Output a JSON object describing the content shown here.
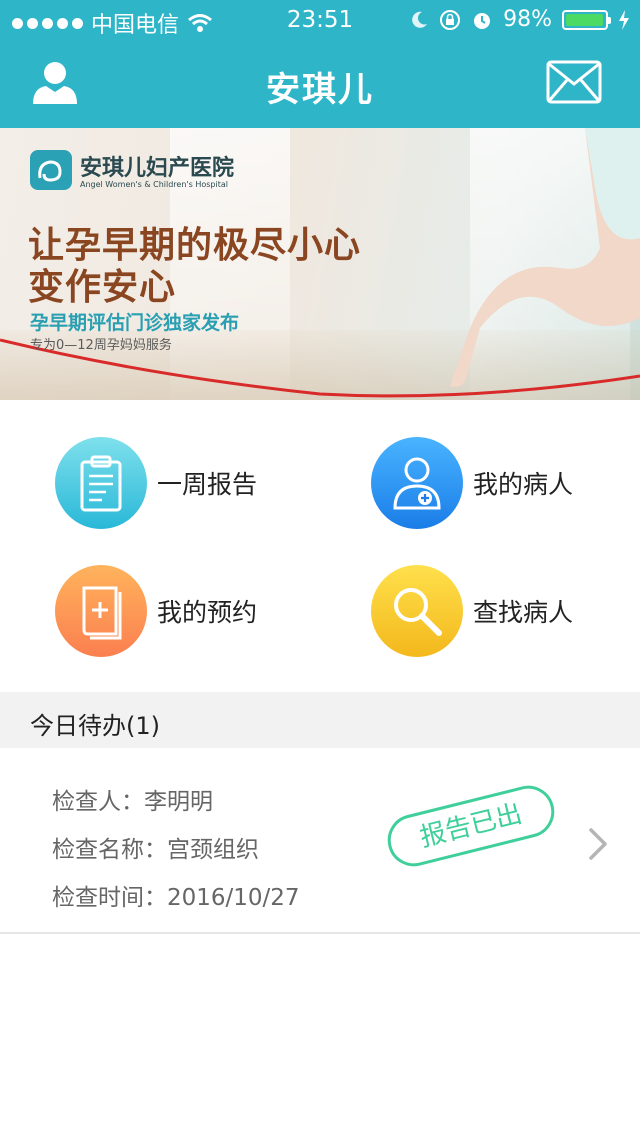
{
  "status_bar": {
    "carrier": "中国电信",
    "time": "23:51",
    "battery_percent": "98%",
    "battery_level": 0.98,
    "icons": [
      "signal-dots-icon",
      "wifi-icon",
      "moon-icon",
      "rotation-lock-icon",
      "alarm-icon",
      "battery-icon",
      "charging-icon"
    ]
  },
  "nav": {
    "title": "安琪儿",
    "left_icon": "user-icon",
    "right_icon": "mail-icon",
    "bar_color": "#2fb5c8"
  },
  "banner": {
    "logo_cn": "安琪儿妇产医院",
    "logo_en": "Angel Women's & Children's Hospital",
    "headline_line1": "让孕早期的极尽小心",
    "headline_line2": "变作安心",
    "subtitle": "孕早期评估门诊独家发布",
    "note": "专为0—12周孕妈妈服务"
  },
  "menu": [
    {
      "label": "一周报告",
      "icon": "clipboard-report-icon",
      "color_top": "#7fe0ec",
      "color_bottom": "#29b8d8"
    },
    {
      "label": "我的病人",
      "icon": "patient-avatar-icon",
      "color_top": "#49b4ff",
      "color_bottom": "#1a7de8"
    },
    {
      "label": "我的预约",
      "icon": "medical-book-icon",
      "color_top": "#ffb35c",
      "color_bottom": "#fb7f50"
    },
    {
      "label": "查找病人",
      "icon": "search-icon",
      "color_top": "#ffe04c",
      "color_bottom": "#f3b81c"
    }
  ],
  "todo": {
    "header": "今日待办(1)",
    "items": [
      {
        "examinee_label": "检查人：",
        "examinee": "李明明",
        "exam_name_label": "检查名称：",
        "exam_name": "宫颈组织",
        "exam_time_label": "检查时间：",
        "exam_time": "2016/10/27",
        "stamp": "报告已出"
      }
    ]
  },
  "colors": {
    "accent": "#2fb5c8",
    "stamp": "#3fcf9a"
  }
}
